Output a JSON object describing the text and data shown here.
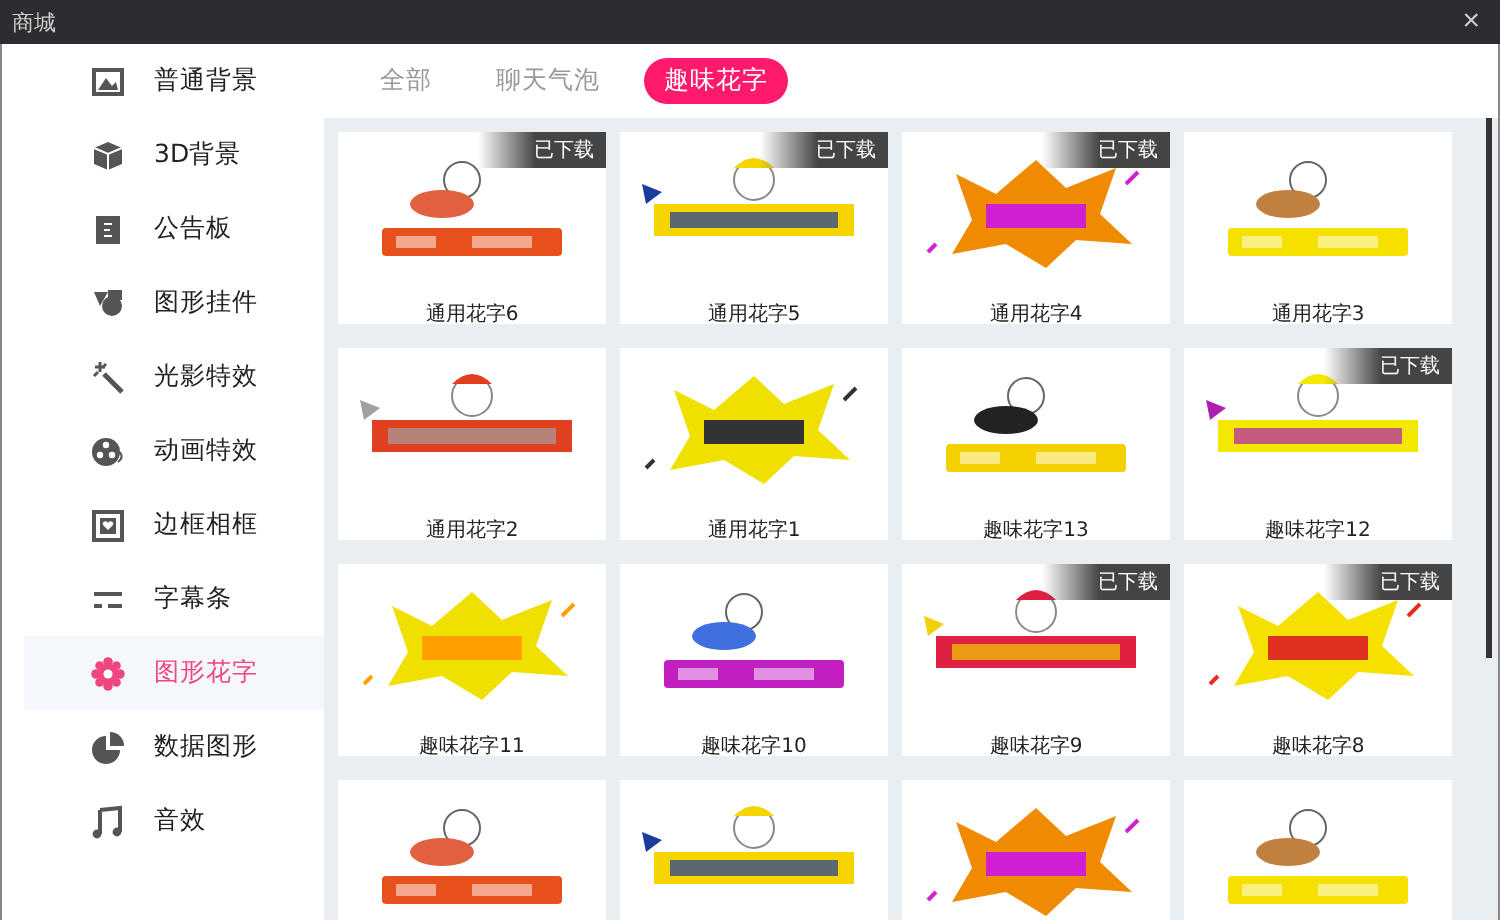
{
  "window": {
    "title": "商城",
    "close": "×"
  },
  "sidebar": {
    "items": [
      {
        "label": "普通背景",
        "selected": false
      },
      {
        "label": "3D背景",
        "selected": false
      },
      {
        "label": "公告板",
        "selected": false
      },
      {
        "label": "图形挂件",
        "selected": false
      },
      {
        "label": "光影特效",
        "selected": false
      },
      {
        "label": "动画特效",
        "selected": false
      },
      {
        "label": "边框相框",
        "selected": false
      },
      {
        "label": "字幕条",
        "selected": false
      },
      {
        "label": "图形花字",
        "selected": true
      },
      {
        "label": "数据图形",
        "selected": false
      },
      {
        "label": "音效",
        "selected": false
      }
    ]
  },
  "tabs": [
    {
      "label": "全部",
      "selected": false
    },
    {
      "label": "聊天气泡",
      "selected": false
    },
    {
      "label": "趣味花字",
      "selected": true
    }
  ],
  "cards": [
    {
      "name": "通用花字6",
      "badge": "已下载"
    },
    {
      "name": "通用花字5",
      "badge": "已下载"
    },
    {
      "name": "通用花字4",
      "badge": "已下载"
    },
    {
      "name": "通用花字3"
    },
    {
      "name": "通用花字2"
    },
    {
      "name": "通用花字1"
    },
    {
      "name": "趣味花字13"
    },
    {
      "name": "趣味花字12",
      "badge": "已下载"
    },
    {
      "name": "趣味花字11"
    },
    {
      "name": "趣味花字10"
    },
    {
      "name": "趣味花字9",
      "badge": "已下载"
    },
    {
      "name": "趣味花字8",
      "badge": "已下载"
    },
    {
      "kind": "picture"
    },
    {
      "kind": "picture"
    },
    {
      "kind": "picture"
    },
    {
      "kind": "picture"
    }
  ]
}
